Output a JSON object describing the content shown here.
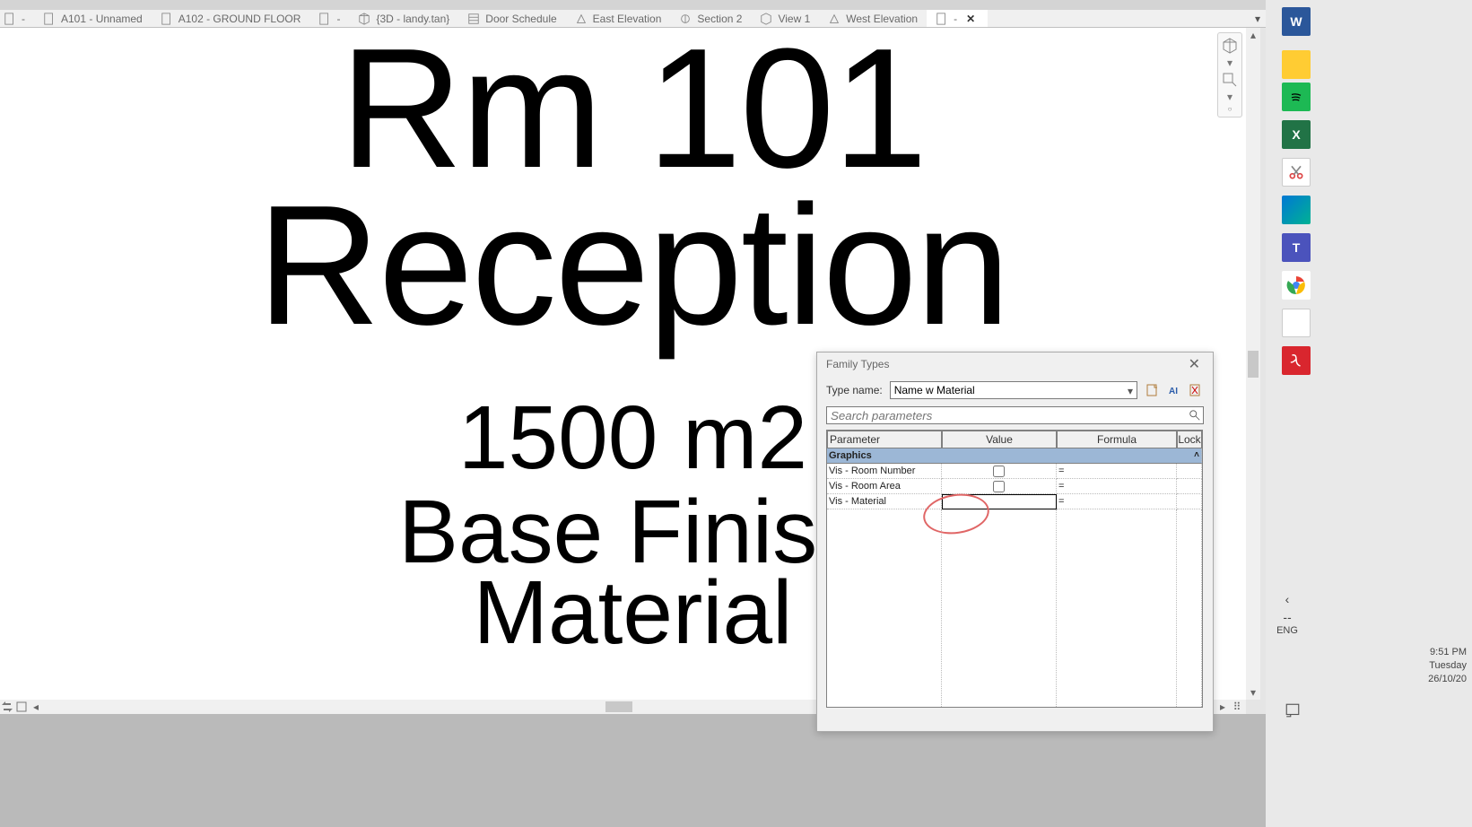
{
  "tabs": [
    {
      "icon": "sheet",
      "label": "-"
    },
    {
      "icon": "sheet",
      "label": "A101 - Unnamed"
    },
    {
      "icon": "sheet",
      "label": "A102 - GROUND FLOOR"
    },
    {
      "icon": "sheet",
      "label": "-"
    },
    {
      "icon": "3d",
      "label": "{3D - landy.tan}"
    },
    {
      "icon": "schedule",
      "label": "Door Schedule"
    },
    {
      "icon": "elevation",
      "label": "East Elevation"
    },
    {
      "icon": "section",
      "label": "Section 2"
    },
    {
      "icon": "3d",
      "label": "View 1"
    },
    {
      "icon": "elevation",
      "label": "West Elevation"
    },
    {
      "icon": "sheet",
      "label": "-",
      "active": true
    }
  ],
  "stage": {
    "room_number": "Rm 101",
    "room_name": "Reception",
    "area": "1500 m2",
    "base_finish": "Base Finish",
    "material": "Material"
  },
  "dialog": {
    "title": "Family Types",
    "type_name_label": "Type name:",
    "type_name_value": "Name w Material",
    "search_placeholder": "Search parameters",
    "headers": {
      "parameter": "Parameter",
      "value": "Value",
      "formula": "Formula",
      "lock": "Lock"
    },
    "group": "Graphics",
    "params": [
      {
        "name": "Vis - Room Number",
        "value_type": "checkbox",
        "checked": false,
        "formula": "="
      },
      {
        "name": "Vis - Room Area",
        "value_type": "checkbox",
        "checked": false,
        "formula": "="
      },
      {
        "name": "Vis - Material",
        "value_type": "text",
        "value": "",
        "formula": "=",
        "active": true
      }
    ]
  },
  "tray": {
    "lang": "ENG",
    "time": "9:51 PM",
    "day": "Tuesday",
    "date": "26/10/20"
  }
}
